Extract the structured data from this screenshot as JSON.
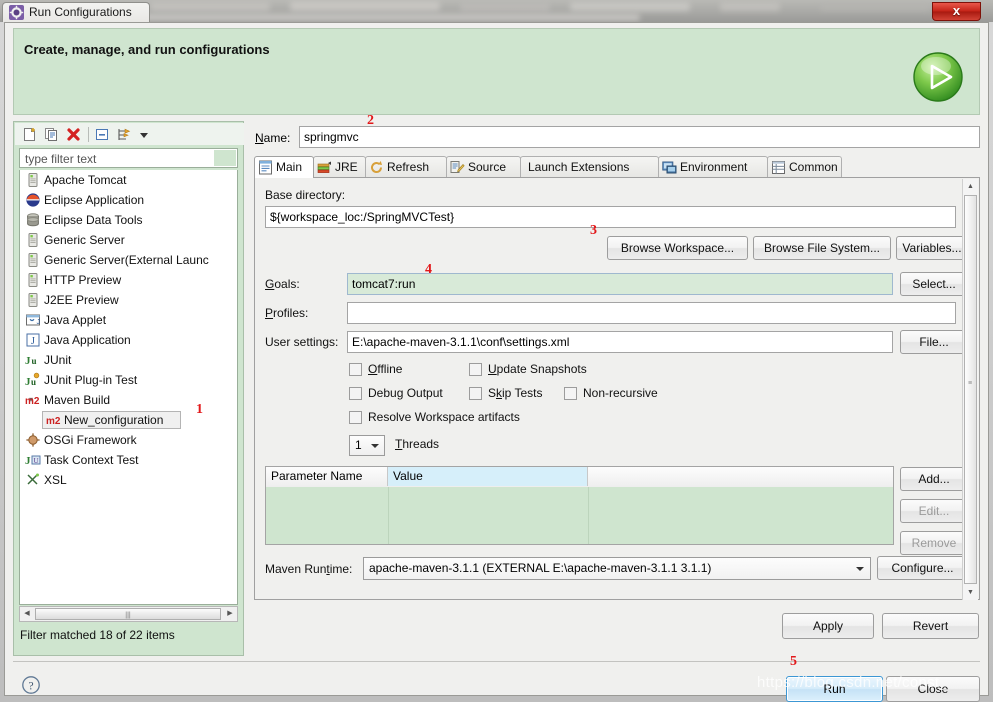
{
  "window": {
    "title": "Run Configurations",
    "icon": "eclipse-run-config-icon",
    "close_label": "x"
  },
  "banner": {
    "title": "Create, manage, and run configurations",
    "icon": "green-run-play-icon"
  },
  "left_panel": {
    "toolbar": [
      {
        "name": "new-launch-configuration-icon",
        "label": "New"
      },
      {
        "name": "duplicate-launch-configuration-icon",
        "label": "Duplicate"
      },
      {
        "name": "delete-launch-configuration-icon",
        "label": "Delete"
      },
      {
        "name": "collapse-all-icon",
        "label": "Collapse All"
      },
      {
        "name": "filter-launch-configurations-icon",
        "label": "Filter"
      },
      {
        "name": "view-menu-chevron-down-icon",
        "label": "View Menu"
      }
    ],
    "filter": {
      "placeholder": "type filter text",
      "value": ""
    },
    "tree": [
      {
        "label": "Apache Tomcat",
        "icon": "server-icon",
        "indent": 0,
        "arrow": "",
        "selected": false
      },
      {
        "label": "Eclipse Application",
        "icon": "eclipse-icon",
        "indent": 0,
        "arrow": "",
        "selected": false
      },
      {
        "label": "Eclipse Data Tools",
        "icon": "database-icon",
        "indent": 0,
        "arrow": "",
        "selected": false
      },
      {
        "label": "Generic Server",
        "icon": "server-icon",
        "indent": 0,
        "arrow": "",
        "selected": false
      },
      {
        "label": "Generic Server(External Launc",
        "icon": "server-icon",
        "indent": 0,
        "arrow": "",
        "selected": false
      },
      {
        "label": "HTTP Preview",
        "icon": "server-icon",
        "indent": 0,
        "arrow": "",
        "selected": false
      },
      {
        "label": "J2EE Preview",
        "icon": "server-icon",
        "indent": 0,
        "arrow": "",
        "selected": false
      },
      {
        "label": "Java Applet",
        "icon": "java-applet-icon",
        "indent": 0,
        "arrow": "",
        "selected": false
      },
      {
        "label": "Java Application",
        "icon": "java-application-icon",
        "indent": 0,
        "arrow": "collapsed",
        "selected": false
      },
      {
        "label": "JUnit",
        "icon": "junit-icon",
        "indent": 0,
        "arrow": "",
        "selected": false
      },
      {
        "label": "JUnit Plug-in Test",
        "icon": "junit-plugin-icon",
        "indent": 0,
        "arrow": "",
        "selected": false
      },
      {
        "label": "Maven Build",
        "icon": "maven-m2-icon",
        "indent": 0,
        "arrow": "expanded",
        "selected": false
      },
      {
        "label": "New_configuration",
        "icon": "maven-m2-icon",
        "indent": 1,
        "arrow": "",
        "selected": true
      },
      {
        "label": "OSGi Framework",
        "icon": "osgi-icon",
        "indent": 0,
        "arrow": "",
        "selected": false
      },
      {
        "label": "Task Context Test",
        "icon": "task-context-test-icon",
        "indent": 0,
        "arrow": "",
        "selected": false
      },
      {
        "label": "XSL",
        "icon": "xsl-icon",
        "indent": 0,
        "arrow": "",
        "selected": false
      }
    ],
    "status": "Filter matched 18 of 22 items"
  },
  "right_panel": {
    "name_label": "Name:",
    "name_value": "springmvc",
    "tabs": [
      {
        "label": "Main",
        "icon": "main-tab-icon",
        "active": true,
        "has_icon": true
      },
      {
        "label": "JRE",
        "icon": "jre-tab-icon",
        "active": false,
        "has_icon": true
      },
      {
        "label": "Refresh",
        "icon": "refresh-tab-icon",
        "active": false,
        "has_icon": true
      },
      {
        "label": "Source",
        "icon": "source-tab-icon",
        "active": false,
        "has_icon": true
      },
      {
        "label": "Launch Extensions",
        "icon": "",
        "active": false,
        "has_icon": false
      },
      {
        "label": "Environment",
        "icon": "environment-tab-icon",
        "active": false,
        "has_icon": true
      },
      {
        "label": "Common",
        "icon": "common-tab-icon",
        "active": false,
        "has_icon": true
      }
    ],
    "main_tab": {
      "base_directory_label": "Base directory:",
      "base_directory_value": "${workspace_loc:/SpringMVCTest}",
      "browse_workspace_label": "Browse Workspace...",
      "browse_file_system_label": "Browse File System...",
      "variables_label": "Variables...",
      "goals_label": "Goals:",
      "goals_value": "tomcat7:run",
      "goals_select_label": "Select...",
      "profiles_label": "Profiles:",
      "profiles_value": "",
      "user_settings_label": "User settings:",
      "user_settings_value": "E:\\apache-maven-3.1.1\\conf\\settings.xml",
      "user_settings_file_label": "File...",
      "checkboxes": [
        {
          "label": "Offline",
          "checked": false
        },
        {
          "label": "Update Snapshots",
          "checked": false
        },
        {
          "label": "Debug Output",
          "checked": false
        },
        {
          "label": "Skip Tests",
          "checked": false
        },
        {
          "label": "Non-recursive",
          "checked": false
        },
        {
          "label": "Resolve Workspace artifacts",
          "checked": false
        }
      ],
      "threads_value": "1",
      "threads_label": "Threads",
      "param_table": {
        "columns": [
          "Parameter Name",
          "Value",
          ""
        ],
        "selected_column": "Value",
        "rows": [
          [
            "",
            "",
            ""
          ],
          [
            "",
            "",
            ""
          ],
          [
            "",
            "",
            ""
          ]
        ]
      },
      "param_buttons": [
        {
          "label": "Add...",
          "enabled": true
        },
        {
          "label": "Edit...",
          "enabled": false
        },
        {
          "label": "Remove",
          "enabled": false
        }
      ],
      "maven_runtime_label": "Maven Runtime:",
      "maven_runtime_value": "apache-maven-3.1.1 (EXTERNAL E:\\apache-maven-3.1.1 3.1.1)",
      "configure_label": "Configure..."
    },
    "apply_label": "Apply",
    "revert_label": "Revert"
  },
  "footer": {
    "help_icon": "help-question-icon",
    "run_label": "Run",
    "close_label": "Close"
  },
  "annotations": [
    {
      "num": "1",
      "target": "tree-selected-item"
    },
    {
      "num": "2",
      "target": "name-field"
    },
    {
      "num": "3",
      "target": "browse-workspace-button"
    },
    {
      "num": "4",
      "target": "goals-field"
    },
    {
      "num": "5",
      "target": "run-button"
    }
  ],
  "watermark": "https://blog.csdn.net/const_",
  "colors": {
    "banner_green": "#cfe5cf",
    "goals_green": "#d8ead8",
    "marker_red": "#e2181a",
    "run_blue": "#3c97d4"
  }
}
